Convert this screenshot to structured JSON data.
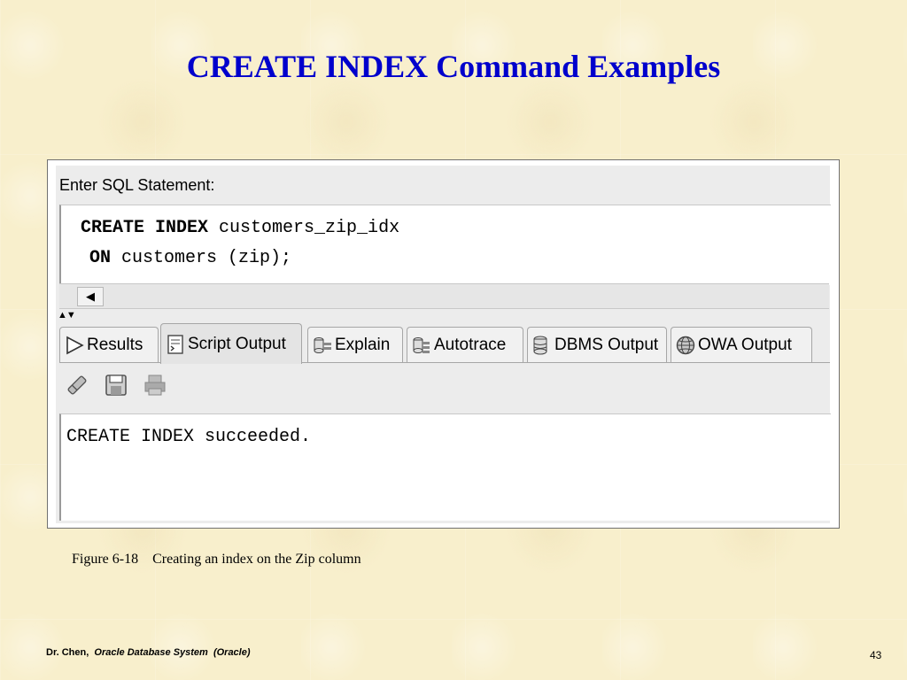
{
  "slide": {
    "title": "CREATE INDEX Command Examples",
    "caption": "Figure 6-18    Creating an index on the Zip column",
    "footer_author": "Dr. Chen,",
    "footer_course": "Oracle Database System  (Oracle)",
    "page_number": "43"
  },
  "editor": {
    "label": "Enter SQL Statement:",
    "line1_keyword": "CREATE INDEX",
    "line1_rest": " customers_zip_idx",
    "line2_keyword": "ON",
    "line2_rest": " customers (zip);"
  },
  "tabs": [
    {
      "label": "Results",
      "icon": "play-icon"
    },
    {
      "label": "Script Output",
      "icon": "script-icon"
    },
    {
      "label": "Explain",
      "icon": "explain-icon"
    },
    {
      "label": "Autotrace",
      "icon": "autotrace-icon"
    },
    {
      "label": "DBMS Output",
      "icon": "database-icon"
    },
    {
      "label": "OWA Output",
      "icon": "globe-icon"
    }
  ],
  "active_tab": "Script Output",
  "toolbar_icons": [
    "eraser-icon",
    "save-icon",
    "print-icon"
  ],
  "output": {
    "text": "CREATE INDEX succeeded."
  },
  "colors": {
    "title": "#0000cc",
    "background": "#f8efcc"
  }
}
